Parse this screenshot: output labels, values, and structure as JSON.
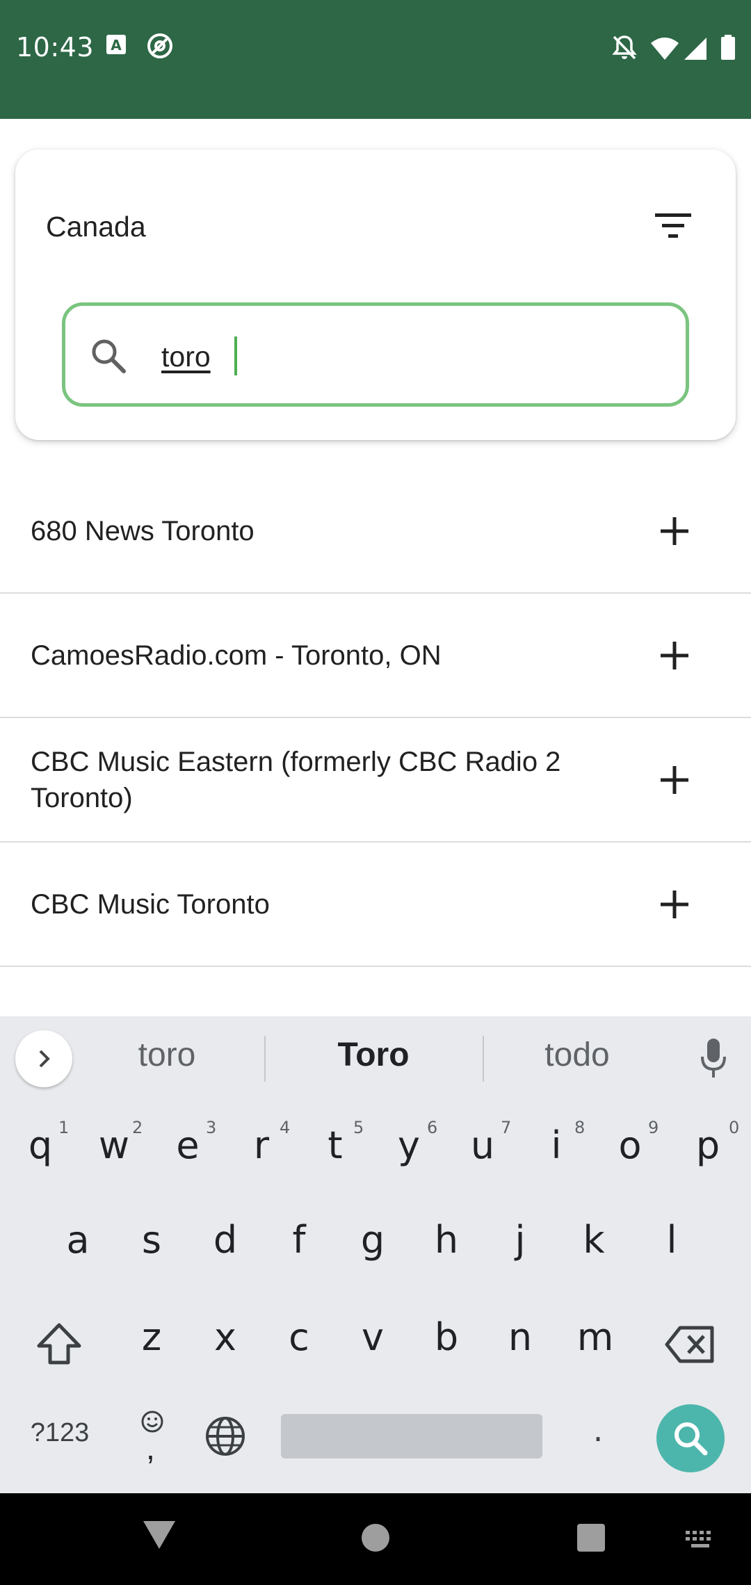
{
  "status_bar": {
    "time": "10:43",
    "icons": [
      "a-square-icon",
      "at-icon",
      "bell-off-icon",
      "wifi-icon",
      "signal-icon",
      "battery-icon"
    ],
    "background": "#2d6746"
  },
  "filter_card": {
    "country": "Canada",
    "filter_icon": "filter-icon",
    "search": {
      "value": "toro",
      "border_color": "#7ac47f"
    }
  },
  "stations": [
    {
      "name": "680 News Toronto",
      "action_icon": "plus-icon"
    },
    {
      "name": "CamoesRadio.com - Toronto, ON",
      "action_icon": "plus-icon"
    },
    {
      "name": "CBC Music Eastern (formerly CBC Radio 2 Toronto)",
      "action_icon": "plus-icon"
    },
    {
      "name": "CBC Music Toronto",
      "action_icon": "plus-icon"
    }
  ],
  "keyboard": {
    "suggestions": [
      "toro",
      "Toro",
      "todo"
    ],
    "row1": [
      "q",
      "w",
      "e",
      "r",
      "t",
      "y",
      "u",
      "i",
      "o",
      "p"
    ],
    "row1_hints": [
      "1",
      "2",
      "3",
      "4",
      "5",
      "6",
      "7",
      "8",
      "9",
      "0"
    ],
    "row2": [
      "a",
      "s",
      "d",
      "f",
      "g",
      "h",
      "j",
      "k",
      "l"
    ],
    "row3": [
      "z",
      "x",
      "c",
      "v",
      "b",
      "n",
      "m"
    ],
    "symbols_key": "?123",
    "comma_key": ",",
    "period_key": ".",
    "action_color": "#4db6ac"
  },
  "nav_bar": {
    "icons": [
      "back-icon",
      "home-icon",
      "recents-icon",
      "keyboard-icon"
    ]
  }
}
